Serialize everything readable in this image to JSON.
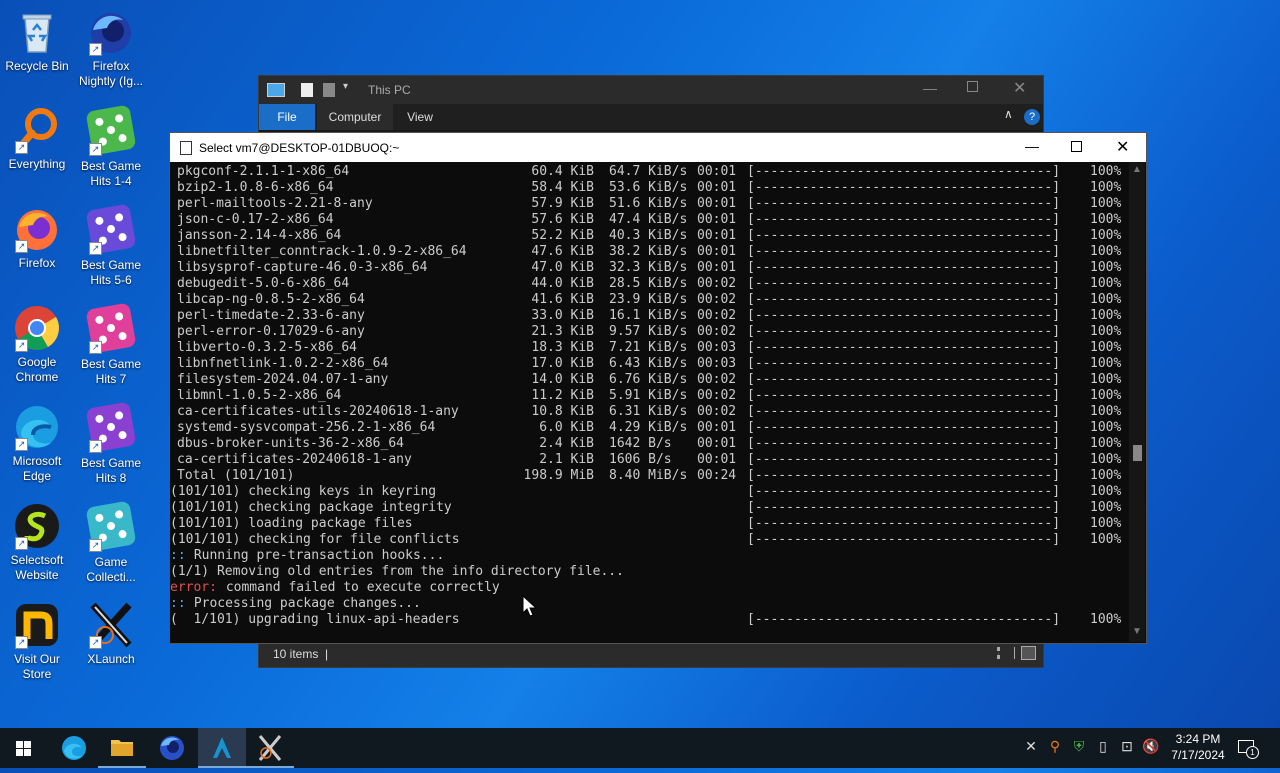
{
  "desktop": {
    "icons": [
      {
        "label": "Recycle Bin"
      },
      {
        "label": "Firefox Nightly (Ig..."
      },
      {
        "label": "Everything"
      },
      {
        "label": "Best Game Hits 1-4"
      },
      {
        "label": "Firefox"
      },
      {
        "label": "Best Game Hits 5-6"
      },
      {
        "label": "Google Chrome"
      },
      {
        "label": "Best Game Hits 7"
      },
      {
        "label": "Microsoft Edge"
      },
      {
        "label": "Best Game Hits 8"
      },
      {
        "label": "Selectsoft Website"
      },
      {
        "label": "Game Collecti..."
      },
      {
        "label": "Visit Our Store"
      },
      {
        "label": "XLaunch"
      }
    ]
  },
  "explorer": {
    "title": "This PC",
    "tabs": [
      "File",
      "Computer",
      "View"
    ],
    "status": "10 items",
    "status_sep": "|"
  },
  "terminal": {
    "title": "Select vm7@DESKTOP-01DBUOQ:~",
    "rows": [
      {
        "name": "pkgconf-2.1.1-1-x86_64",
        "size": "60.4 KiB",
        "rate": "64.7 KiB/s",
        "time": "00:01"
      },
      {
        "name": "bzip2-1.0.8-6-x86_64",
        "size": "58.4 KiB",
        "rate": "53.6 KiB/s",
        "time": "00:01"
      },
      {
        "name": "perl-mailtools-2.21-8-any",
        "size": "57.9 KiB",
        "rate": "51.6 KiB/s",
        "time": "00:01"
      },
      {
        "name": "json-c-0.17-2-x86_64",
        "size": "57.6 KiB",
        "rate": "47.4 KiB/s",
        "time": "00:01"
      },
      {
        "name": "jansson-2.14-4-x86_64",
        "size": "52.2 KiB",
        "rate": "40.3 KiB/s",
        "time": "00:01"
      },
      {
        "name": "libnetfilter_conntrack-1.0.9-2-x86_64",
        "size": "47.6 KiB",
        "rate": "38.2 KiB/s",
        "time": "00:01"
      },
      {
        "name": "libsysprof-capture-46.0-3-x86_64",
        "size": "47.0 KiB",
        "rate": "32.3 KiB/s",
        "time": "00:01"
      },
      {
        "name": "debugedit-5.0-6-x86_64",
        "size": "44.0 KiB",
        "rate": "28.5 KiB/s",
        "time": "00:02"
      },
      {
        "name": "libcap-ng-0.8.5-2-x86_64",
        "size": "41.6 KiB",
        "rate": "23.9 KiB/s",
        "time": "00:02"
      },
      {
        "name": "perl-timedate-2.33-6-any",
        "size": "33.0 KiB",
        "rate": "16.1 KiB/s",
        "time": "00:02"
      },
      {
        "name": "perl-error-0.17029-6-any",
        "size": "21.3 KiB",
        "rate": "9.57 KiB/s",
        "time": "00:02"
      },
      {
        "name": "libverto-0.3.2-5-x86_64",
        "size": "18.3 KiB",
        "rate": "7.21 KiB/s",
        "time": "00:03"
      },
      {
        "name": "libnfnetlink-1.0.2-2-x86_64",
        "size": "17.0 KiB",
        "rate": "6.43 KiB/s",
        "time": "00:03"
      },
      {
        "name": "filesystem-2024.04.07-1-any",
        "size": "14.0 KiB",
        "rate": "6.76 KiB/s",
        "time": "00:02"
      },
      {
        "name": "libmnl-1.0.5-2-x86_64",
        "size": "11.2 KiB",
        "rate": "5.91 KiB/s",
        "time": "00:02"
      },
      {
        "name": "ca-certificates-utils-20240618-1-any",
        "size": "10.8 KiB",
        "rate": "6.31 KiB/s",
        "time": "00:02"
      },
      {
        "name": "systemd-sysvcompat-256.2-1-x86_64",
        "size": "6.0 KiB",
        "rate": "4.29 KiB/s",
        "time": "00:01"
      },
      {
        "name": "dbus-broker-units-36-2-x86_64",
        "size": "2.4 KiB",
        "rate": "1642 B/s",
        "time": "00:01"
      },
      {
        "name": "ca-certificates-20240618-1-any",
        "size": "2.1 KiB",
        "rate": "1606 B/s",
        "time": "00:01"
      },
      {
        "name": "Total (101/101)",
        "size": "198.9 MiB",
        "rate": "8.40 MiB/s",
        "time": "00:24"
      }
    ],
    "checks": [
      "(101/101) checking keys in keyring",
      "(101/101) checking package integrity",
      "(101/101) loading package files",
      "(101/101) checking for file conflicts"
    ],
    "bar": "[--------------------------------------]",
    "percent": "100%",
    "hooks_prefix": "::",
    "hooks_text": " Running pre-transaction hooks...",
    "removing": "(1/1) Removing old entries from the info directory file...",
    "error_prefix": "error:",
    "error_text": " command failed to execute correctly",
    "processing_prefix": "::",
    "processing_text": " Processing package changes...",
    "upgrading": "(  1/101) upgrading linux-api-headers"
  },
  "taskbar": {
    "time": "3:24 PM",
    "date": "7/17/2024",
    "notification_count": "1"
  },
  "colors": {
    "error": "#e05050",
    "prompt": "#5aa0e8",
    "accent": "#0078d7"
  }
}
